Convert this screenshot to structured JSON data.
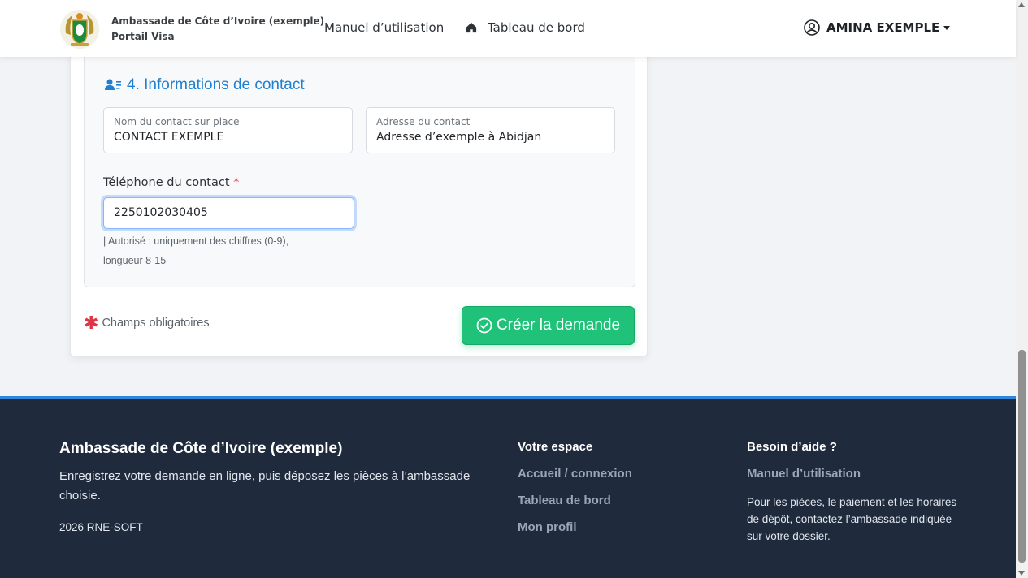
{
  "navbar": {
    "brand_line1": "Ambassade de Côte d’Ivoire (exemple)",
    "brand_line2": "Portail Visa",
    "manual_link": "Manuel d’utilisation",
    "dashboard_link": "Tableau de bord",
    "user_name": "AMINA EXEMPLE"
  },
  "section": {
    "title": "4. Informations de contact",
    "contact_name": {
      "label": "Nom du contact sur place",
      "value": "CONTACT EXEMPLE"
    },
    "contact_address": {
      "label": "Adresse du contact",
      "value": "Adresse d’exemple à Abidjan"
    },
    "phone": {
      "label": "Téléphone du contact",
      "required_marker": "*",
      "value": "2250102030405",
      "help": "| Autorisé : uniquement des chiffres (0-9), longueur 8-15"
    }
  },
  "form_footer": {
    "required_note": "Champs obligatoires",
    "submit_label": "Créer la demande"
  },
  "footer": {
    "title": "Ambassade de Côte d’Ivoire (exemple)",
    "description": "Enregistrez votre demande en ligne, puis déposez les pièces à l’ambassade choisie.",
    "copyright": "2026 RNE-SOFT",
    "space_heading": "Votre espace",
    "space_links": [
      "Accueil / connexion",
      "Tableau de bord",
      "Mon profil"
    ],
    "help_heading": "Besoin d’aide ?",
    "help_link": "Manuel d’utilisation",
    "help_text": "Pour les pièces, le paiement et les horaires de dépôt, contactez l’ambassade indiquée sur votre dossier."
  },
  "colors": {
    "accent_blue": "#1f7fd1",
    "success_green": "#20c27a",
    "footer_bg": "#1f2a3c",
    "required_red": "#dc3545"
  }
}
